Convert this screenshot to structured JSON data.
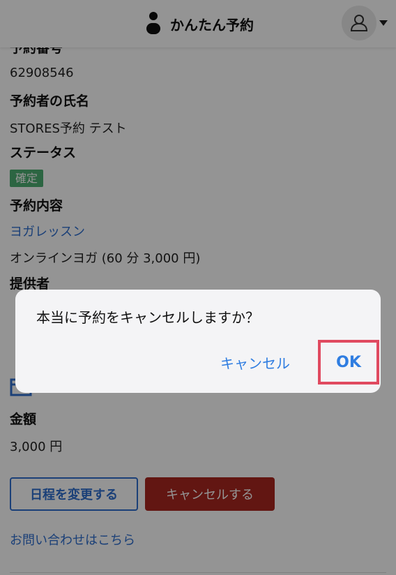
{
  "header": {
    "app_name": "かんたん予約"
  },
  "reservation": {
    "number_label": "予約番号",
    "number": "62908546",
    "name_label": "予約者の氏名",
    "name": "STORES予約 テスト",
    "status_label": "ステータス",
    "status": "確定",
    "content_label": "予約内容",
    "service_link": "ヨガレッスン",
    "service_detail": "オンラインヨガ (60 分 3,000 円)",
    "provider_label": "提供者",
    "amount_label": "金額",
    "amount": "3,000 円"
  },
  "actions": {
    "change_label": "日程を変更する",
    "cancel_label": "キャンセルする",
    "contact_link": "お問い合わせはこちら"
  },
  "dialog": {
    "message": "本当に予約をキャンセルしますか？",
    "cancel_label": "キャンセル",
    "ok_label": "OK"
  },
  "colors": {
    "accent": "#2f6fcf",
    "danger": "#a9261f",
    "status_green": "#4caf73",
    "highlight": "#e04a60"
  }
}
